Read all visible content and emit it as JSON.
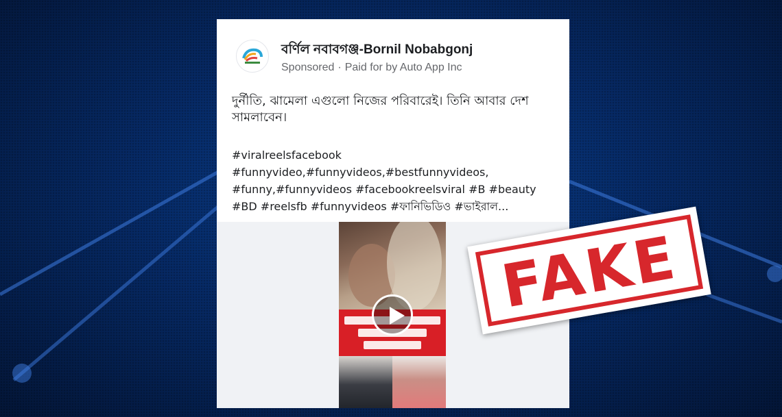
{
  "post": {
    "page_name": "বর্ণিল নবাবগঞ্জ-Bornil Nobabgonj",
    "sponsored_label": "Sponsored",
    "separator": "·",
    "paid_for_by": "Paid for by Auto App Inc",
    "text": "দুর্নীতি, ঝামেলা এগুলো নিজের পরিবারেই। তিনি আবার দেশ সামলাবেন।",
    "hashtag_lines": [
      "#viralreelsfacebook",
      "#funnyvideo,#funnyvideos,#bestfunnyvideos,",
      "#funny,#funnyvideos #facebookreelsviral #B #beauty",
      "#BD #reelsfb #funnyvideos #ফানিভিডিও #ভাইরাল..."
    ]
  },
  "video": {
    "play_icon": "play-icon"
  },
  "stamp": {
    "text": "FAKE",
    "color": "#d7272c"
  },
  "colors": {
    "background": "#062a66",
    "card": "#ffffff",
    "caption_red": "#d81f26"
  }
}
